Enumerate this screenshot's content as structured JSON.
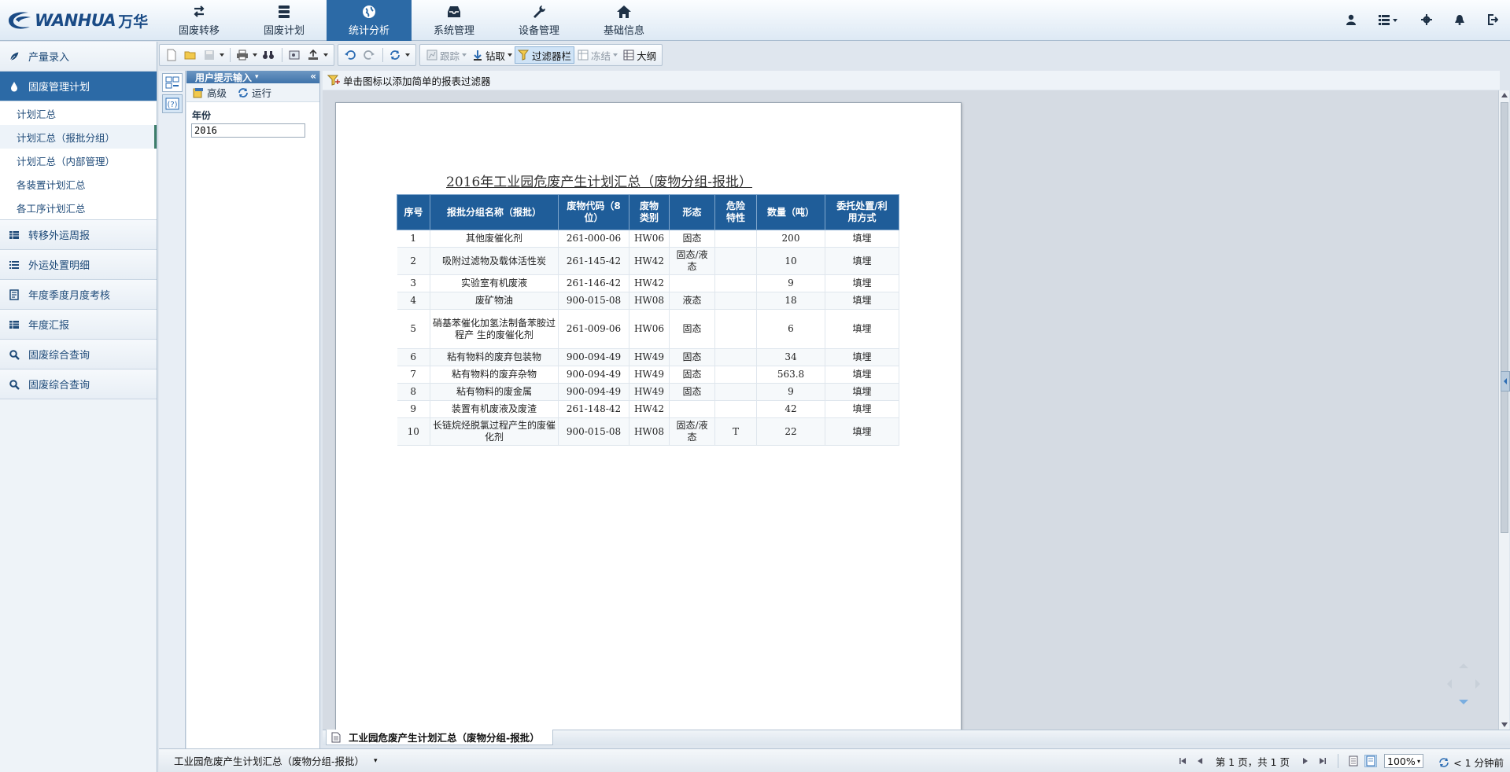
{
  "brand": {
    "name": "WANHUA",
    "name_cn": "万华",
    "color": "#1a4b86"
  },
  "nav": {
    "items": [
      {
        "label": "固废转移",
        "icon": "transfer-icon"
      },
      {
        "label": "固废计划",
        "icon": "database-icon"
      },
      {
        "label": "统计分析",
        "icon": "globe-icon",
        "active": true
      },
      {
        "label": "系统管理",
        "icon": "inbox-icon"
      },
      {
        "label": "设备管理",
        "icon": "wrench-icon"
      },
      {
        "label": "基础信息",
        "icon": "home-icon"
      }
    ],
    "active_color": "#2c6aa6"
  },
  "top_icons": [
    "user-icon",
    "list-menu-icon",
    "gear-icon",
    "bell-icon",
    "logout-icon"
  ],
  "sidebar": {
    "items": [
      {
        "label": "产量录入",
        "icon": "leaf-icon"
      },
      {
        "label": "固废管理计划",
        "icon": "drop-icon",
        "active": true
      },
      {
        "label": "转移外运周报",
        "icon": "table-icon"
      },
      {
        "label": "外运处置明细",
        "icon": "list-icon"
      },
      {
        "label": "年度季度月度考核",
        "icon": "report-icon"
      },
      {
        "label": "年度汇报",
        "icon": "table-icon"
      },
      {
        "label": "固废综合查询",
        "icon": "search-icon"
      },
      {
        "label": "固废综合查询",
        "icon": "search-icon"
      }
    ],
    "sub_items": [
      "计划汇总",
      "计划汇总（报批分组）",
      "计划汇总（内部管理）",
      "各装置计划汇总",
      "各工序计划汇总"
    ],
    "selected_sub": 1
  },
  "toolbar": {
    "track_label": "跟踪",
    "drill_label": "钻取",
    "filter_bar_label": "过滤器栏",
    "freeze_label": "冻结",
    "outline_label": "大纲"
  },
  "prompt_panel": {
    "title": "用户提示输入",
    "advanced_label": "高级",
    "run_label": "运行",
    "year_label": "年份",
    "year_value": "2016"
  },
  "filter_hint": "单击图标以添加简单的报表过滤器",
  "report": {
    "title": "2016年工业园危废产生计划汇总（废物分组-报批）",
    "headers": [
      "序号",
      "报批分组名称（报批）",
      "废物代码（8位）",
      "废物类别",
      "形态",
      "危险特性",
      "数量（吨）",
      "委托处置/利用方式"
    ],
    "rows": [
      [
        "1",
        "其他废催化剂",
        "261-000-06",
        "HW06",
        "固态",
        "",
        "200",
        "填埋"
      ],
      [
        "2",
        "吸附过滤物及载体活性炭",
        "261-145-42",
        "HW42",
        "固态/液态",
        "",
        "10",
        "填埋"
      ],
      [
        "3",
        "实验室有机废液",
        "261-146-42",
        "HW42",
        "",
        "",
        "9",
        "填埋"
      ],
      [
        "4",
        "废矿物油",
        "900-015-08",
        "HW08",
        "液态",
        "",
        "18",
        "填埋"
      ],
      [
        "5",
        "硝基苯催化加氢法制备苯胺过程产 生的废催化剂",
        "261-009-06",
        "HW06",
        "固态",
        "",
        "6",
        "填埋"
      ],
      [
        "6",
        "粘有物料的废弃包装物",
        "900-094-49",
        "HW49",
        "固态",
        "",
        "34",
        "填埋"
      ],
      [
        "7",
        "粘有物料的废弃杂物",
        "900-094-49",
        "HW49",
        "固态",
        "",
        "563.8",
        "填埋"
      ],
      [
        "8",
        "粘有物料的废金属",
        "900-094-49",
        "HW49",
        "固态",
        "",
        "9",
        "填埋"
      ],
      [
        "9",
        "装置有机废液及废渣",
        "261-148-42",
        "HW42",
        "",
        "",
        "42",
        "填埋"
      ],
      [
        "10",
        "长链烷烃脱氯过程产生的废催化剂",
        "900-015-08",
        "HW08",
        "固态/液态",
        "T",
        "22",
        "填埋"
      ]
    ],
    "header_color": "#1f5d99"
  },
  "tab": {
    "label": "工业园危废产生计划汇总（废物分组-报批）"
  },
  "status": {
    "report_name": "工业园危废产生计划汇总（废物分组-报批）",
    "page_text": "第 1 页，共 1 页",
    "zoom": "100%",
    "refresh_text": "< 1 分钟前"
  }
}
